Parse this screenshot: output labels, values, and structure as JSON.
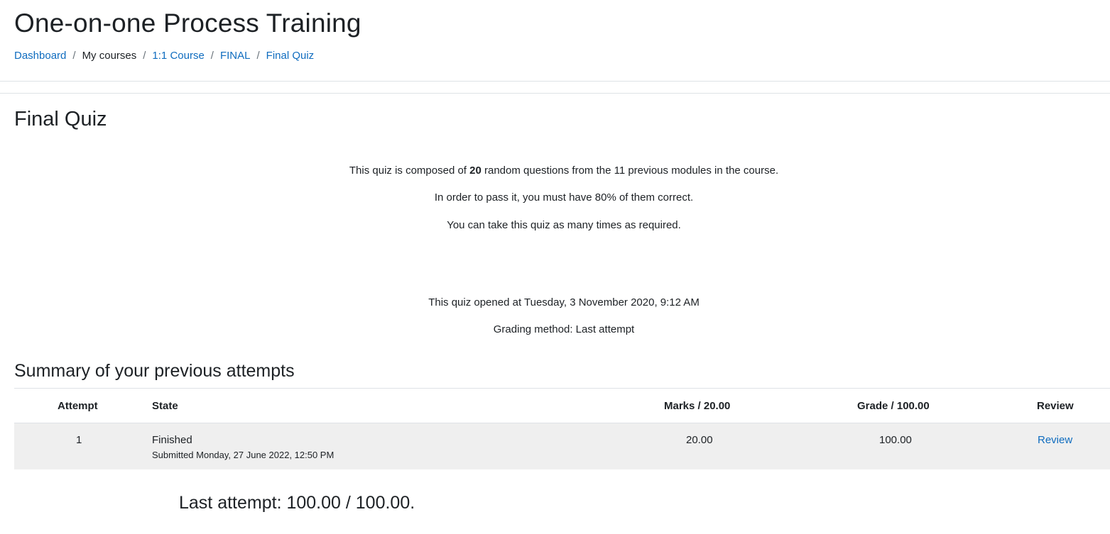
{
  "header": {
    "course_title": "One-on-one Process Training",
    "breadcrumb": [
      {
        "label": "Dashboard",
        "link": true
      },
      {
        "label": "My courses",
        "link": false
      },
      {
        "label": "1:1 Course",
        "link": true
      },
      {
        "label": "FINAL",
        "link": true
      },
      {
        "label": "Final Quiz",
        "link": true
      }
    ],
    "separator": "/"
  },
  "quiz": {
    "title": "Final Quiz",
    "intro_line1_pre": "This quiz is composed of ",
    "intro_line1_count": "20",
    "intro_line1_post": " random questions from the 11 previous modules in the course.",
    "intro_line2": "In order to pass it, you must have 80% of them correct.",
    "intro_line3": "You can take this quiz as many times as required.",
    "opened": "This quiz opened at Tuesday, 3 November 2020, 9:12 AM",
    "grading_method": "Grading method: Last attempt"
  },
  "summary": {
    "title": "Summary of your previous attempts",
    "columns": {
      "attempt": "Attempt",
      "state": "State",
      "marks": "Marks / 20.00",
      "grade": "Grade / 100.00",
      "review": "Review"
    },
    "rows": [
      {
        "attempt": "1",
        "state": "Finished",
        "submitted": "Submitted Monday, 27 June 2022, 12:50 PM",
        "marks": "20.00",
        "grade": "100.00",
        "review": "Review"
      }
    ]
  },
  "result": {
    "last_attempt": "Last attempt: 100.00 / 100.00."
  },
  "colors": {
    "link": "#0f6cbf",
    "text": "#1d2125",
    "row_bg": "#efefef",
    "border": "#dee2e6"
  }
}
